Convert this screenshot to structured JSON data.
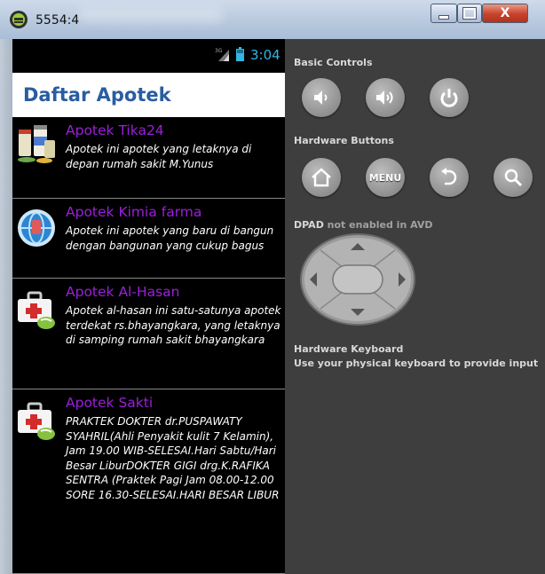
{
  "window": {
    "title": "5554:4",
    "close_glyph": "X"
  },
  "device": {
    "status_bar": {
      "network": "3G",
      "time": "3:04",
      "time_color": "#33b5e5"
    },
    "app_bar": {
      "title": "Daftar Apotek",
      "title_color": "#2a5ca0"
    },
    "list": [
      {
        "name": "Apotek Tika24",
        "icon": "medicine-bottles-icon",
        "description": "Apotek ini apotek yang letaknya di depan rumah sakit M.Yunus"
      },
      {
        "name": "Apotek Kimia farma",
        "icon": "globe-icon",
        "description": "Apotek ini apotek yang baru di bangun dengan bangunan yang cukup bagus"
      },
      {
        "name": "Apotek Al-Hasan",
        "icon": "first-aid-kit-icon",
        "description": "Apotek al-hasan ini satu-satunya apotek terdekat rs.bhayangkara, yang letaknya di samping rumah sakit bhayangkara"
      },
      {
        "name": "Apotek Sakti",
        "icon": "first-aid-kit-icon",
        "description": "PRAKTEK DOKTER dr.PUSPAWATY SYAHRIL(Ahli Penyakit kulit 7 Kelamin), Jam 19.00 WIB-SELESAI.Hari Sabtu/Hari Besar LiburDOKTER GIGI drg.K.RAFIKA SENTRA (Praktek Pagi Jam 08.00-12.00 SORE 16.30-SELESAI.HARI BESAR LIBUR"
      }
    ],
    "name_color": "#9b1fd9"
  },
  "controls": {
    "basic_controls_label": "Basic Controls",
    "hardware_buttons_label": "Hardware Buttons",
    "menu_label": "MENU",
    "dpad_label": "DPAD",
    "dpad_status": "not enabled in AVD",
    "keyboard_title": "Hardware Keyboard",
    "keyboard_desc": "Use your physical keyboard to provide input"
  }
}
